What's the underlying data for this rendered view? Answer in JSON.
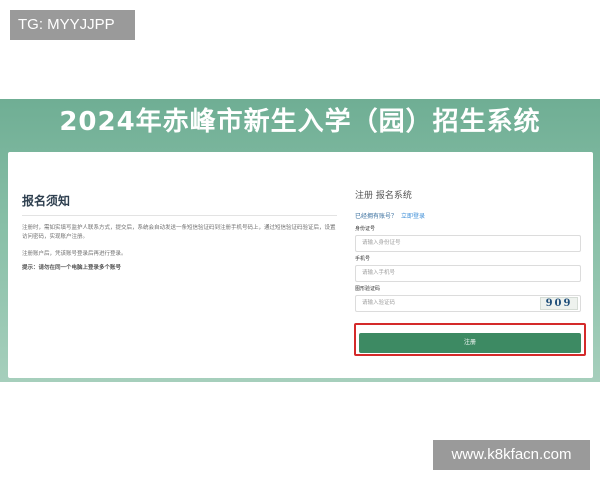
{
  "watermark_top": "TG: MYYJJPP",
  "watermark_bottom": "www.k8kfacn.com",
  "banner": {
    "title": "2024年赤峰市新生入学（园）招生系统"
  },
  "notice": {
    "title": "报名须知",
    "paragraphs": [
      "注册时，需如实填写监护人联系方式，提交后，系统会自动发送一条短信验证码到注册手机号码上，通过短信验证码验证后，设置访问密码，实现账户注册。",
      "注册账户后，凭该账号登录后再进行登录。"
    ],
    "tip": "提示：请勿在同一个电脑上登录多个账号"
  },
  "register": {
    "title": "注册 报名系统",
    "has_account": "已经拥有账号？",
    "login_link": "立即登录",
    "fields": [
      {
        "label": "身份证号",
        "placeholder": "请输入身份证号"
      },
      {
        "label": "手机号",
        "placeholder": "请输入手机号"
      },
      {
        "label": "图形验证码",
        "placeholder": "请输入验证码"
      }
    ],
    "captcha": "909",
    "submit_label": "注册"
  },
  "colors": {
    "banner_green": "#6fae94",
    "button_green": "#3d8a63",
    "highlight_red": "#d42a2a",
    "link_blue": "#3f8fd8"
  }
}
